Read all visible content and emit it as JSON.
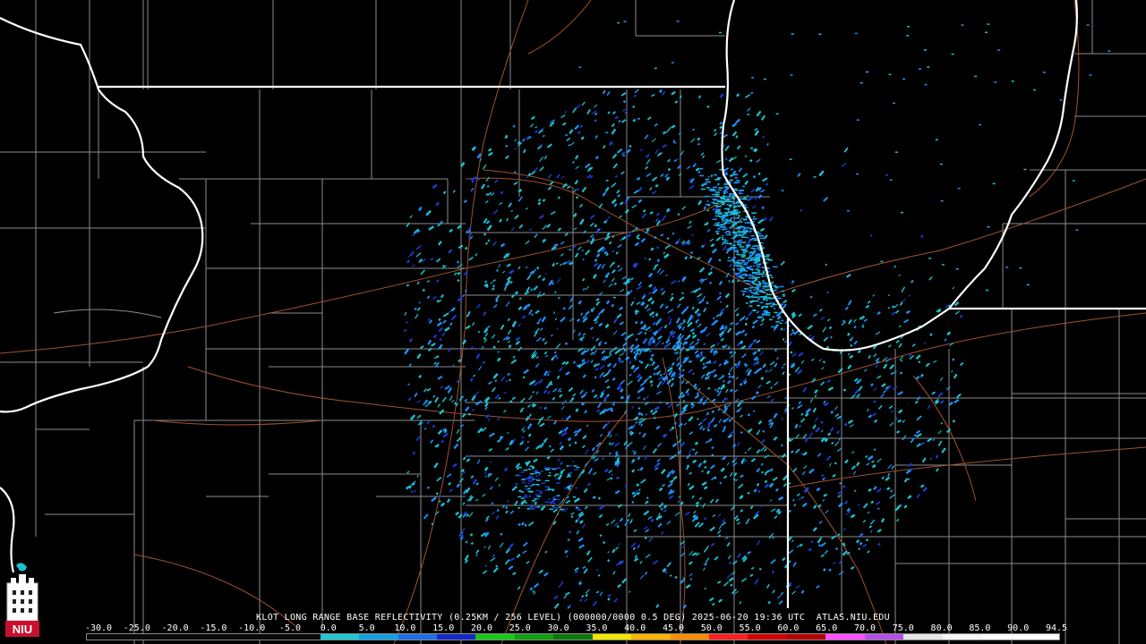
{
  "caption": "KLOT LONG RANGE BASE REFLECTIVITY (0.25KM / 256 LEVEL) (000000/0000 0.5 DEG) 2025-06-20 19:36 UTC  ATLAS.NIU.EDU",
  "logo_text": "NIU",
  "scale_labels": [
    "-30.0",
    "-25.0",
    "-20.0",
    "-15.0",
    "-10.0",
    "-5.0",
    "0.0",
    "5.0",
    "10.0",
    "15.0",
    "20.0",
    "25.0",
    "30.0",
    "35.0",
    "40.0",
    "45.0",
    "50.0",
    "55.0",
    "60.0",
    "65.0",
    "70.0",
    "75.0",
    "80.0",
    "85.0",
    "90.0",
    "94.5"
  ],
  "colors": {
    "background": "#000000",
    "state_border": "#ffffff",
    "county_border": "#8c8c8c",
    "highway": "#a0522d",
    "echo_light": "#19c3d2",
    "echo_mid": "#1e90ff",
    "echo_strong": "#1a3cd6"
  },
  "scale_colors": [
    "#0a0a0a",
    "#0a0a0a",
    "#0a0a0a",
    "#0a0a0a",
    "#0a0a0a",
    "#0a0a0a",
    "#20c8d0",
    "#14a0e0",
    "#1e6ee6",
    "#1428c8",
    "#18c818",
    "#10a010",
    "#0a780a",
    "#f0e600",
    "#ffb400",
    "#ff8c00",
    "#ff2020",
    "#d20000",
    "#b40000",
    "#ff50ff",
    "#b450e6",
    "#e6e6e6",
    "#f5f5f5",
    "#ffffff",
    "#ffffff"
  ]
}
